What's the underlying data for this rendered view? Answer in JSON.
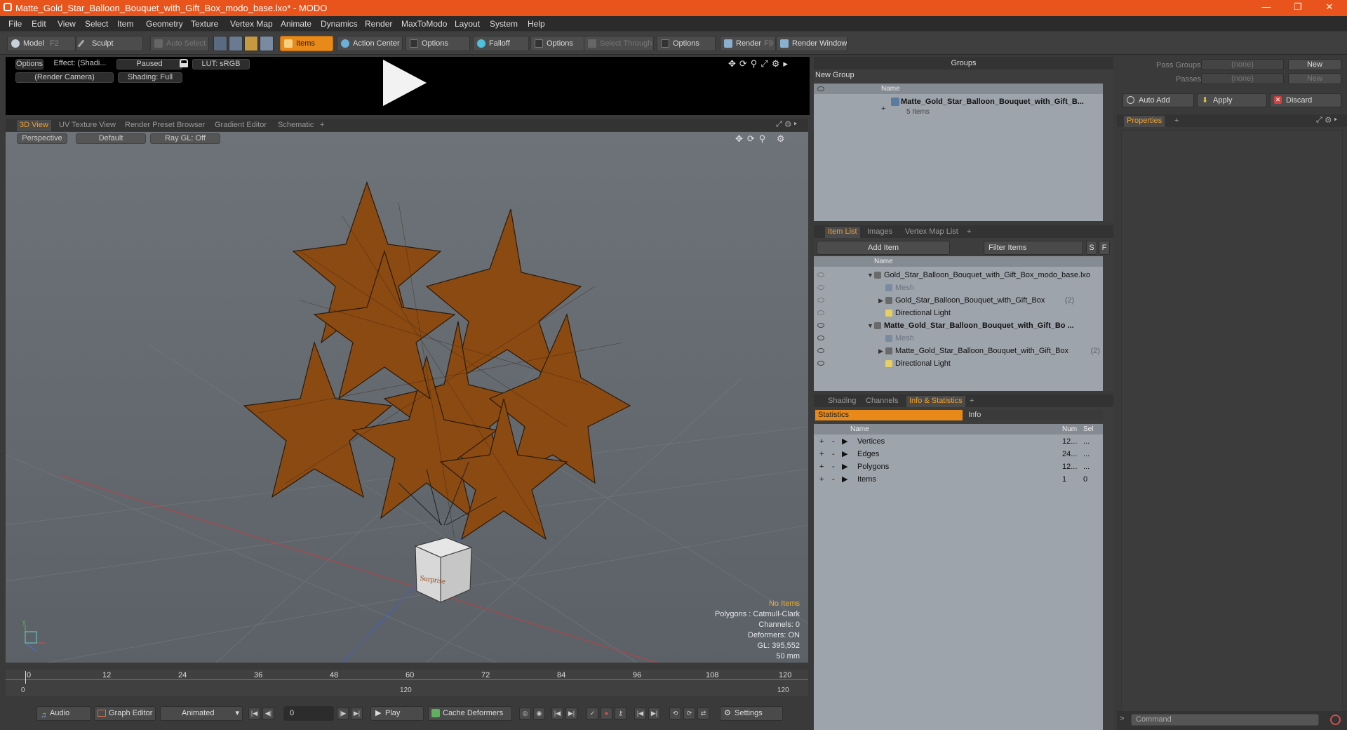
{
  "window": {
    "title": "Matte_Gold_Star_Balloon_Bouquet_with_Gift_Box_modo_base.lxo* - MODO",
    "minimize": "—",
    "restore": "❐",
    "close": "✕"
  },
  "menu": [
    "File",
    "Edit",
    "View",
    "Select",
    "Item",
    "Geometry",
    "Texture",
    "Vertex Map",
    "Animate",
    "Dynamics",
    "Render",
    "MaxToModo",
    "Layout",
    "System",
    "Help"
  ],
  "toolbar": {
    "model": "Model",
    "model_key": "F2",
    "sculpt": "Sculpt",
    "auto_select": "Auto Select",
    "items": "Items",
    "action_center": "Action Center",
    "options1": "Options",
    "falloff": "Falloff",
    "options2": "Options",
    "select_through": "Select Through",
    "options3": "Options",
    "render": "Render",
    "render_key": "F9",
    "render_window": "Render Window"
  },
  "preview": {
    "options": "Options",
    "effect": "Effect: (Shadi...",
    "paused": "Paused",
    "lut": "LUT: sRGB",
    "camera": "(Render Camera)",
    "shading": "Shading: Full"
  },
  "viewport_tabs": [
    "3D View",
    "UV Texture View",
    "Render Preset Browser",
    "Gradient Editor",
    "Schematic",
    "+"
  ],
  "viewport": {
    "projection": "Perspective",
    "style": "Default",
    "raygl": "Ray GL: Off",
    "box_label": "Surprise",
    "axis_y": "y",
    "stats": {
      "no_items": "No Items",
      "polygons": "Polygons : Catmull-Clark",
      "channels": "Channels: 0",
      "deformers": "Deformers: ON",
      "gl": "GL: 395,552",
      "focal": "50 mm"
    }
  },
  "timeline": {
    "ticks": [
      "0",
      "12",
      "24",
      "36",
      "48",
      "60",
      "72",
      "84",
      "96",
      "108",
      "120"
    ],
    "sub": {
      "start": "0",
      "mid": "120",
      "end": "120"
    }
  },
  "bottom": {
    "audio": "Audio",
    "graph_editor": "Graph Editor",
    "animated": "Animated",
    "frame": "0",
    "play": "Play",
    "cache": "Cache Deformers",
    "settings": "Settings"
  },
  "groups": {
    "title": "Groups",
    "new_group": "New Group",
    "col_name": "Name",
    "item_name": "Matte_Gold_Star_Balloon_Bouquet_with_Gift_B...",
    "item_count": "5 Items"
  },
  "item_list": {
    "tabs": [
      "Item List",
      "Images",
      "Vertex Map List",
      "+"
    ],
    "add_item": "Add Item",
    "filter": "Filter Items",
    "s": "S",
    "f": "F",
    "col_name": "Name",
    "rows": [
      {
        "label": "Gold_Star_Balloon_Bouquet_with_Gift_Box_modo_base.lxo",
        "suffix": "",
        "bold": false
      },
      {
        "label": "Mesh",
        "suffix": "",
        "bold": false
      },
      {
        "label": "Gold_Star_Balloon_Bouquet_with_Gift_Box",
        "suffix": "(2)",
        "bold": false
      },
      {
        "label": "Directional Light",
        "suffix": "",
        "bold": false
      },
      {
        "label": "Matte_Gold_Star_Balloon_Bouquet_with_Gift_Bo ...",
        "suffix": "",
        "bold": true
      },
      {
        "label": "Mesh",
        "suffix": "",
        "bold": false
      },
      {
        "label": "Matte_Gold_Star_Balloon_Bouquet_with_Gift_Box",
        "suffix": "(2)",
        "bold": false
      },
      {
        "label": "Directional Light",
        "suffix": "",
        "bold": false
      }
    ]
  },
  "stats_panel": {
    "tabs": [
      "Shading",
      "Channels",
      "Info & Statistics",
      "+"
    ],
    "statistics": "Statistics",
    "info": "Info",
    "cols": {
      "name": "Name",
      "num": "Num",
      "sel": "Sel"
    },
    "rows": [
      {
        "name": "Vertices",
        "num": "12...",
        "sel": "..."
      },
      {
        "name": "Edges",
        "num": "24...",
        "sel": "..."
      },
      {
        "name": "Polygons",
        "num": "12...",
        "sel": "..."
      },
      {
        "name": "Items",
        "num": "1",
        "sel": "0"
      }
    ]
  },
  "right": {
    "pass_groups": "Pass Groups",
    "passes": "Passes",
    "none1": "(none)",
    "none2": "(none)",
    "new1": "New",
    "new2": "New",
    "auto_add": "Auto Add",
    "apply": "Apply",
    "discard": "Discard",
    "properties": "Properties",
    "plus": "+",
    "command": "Command"
  }
}
